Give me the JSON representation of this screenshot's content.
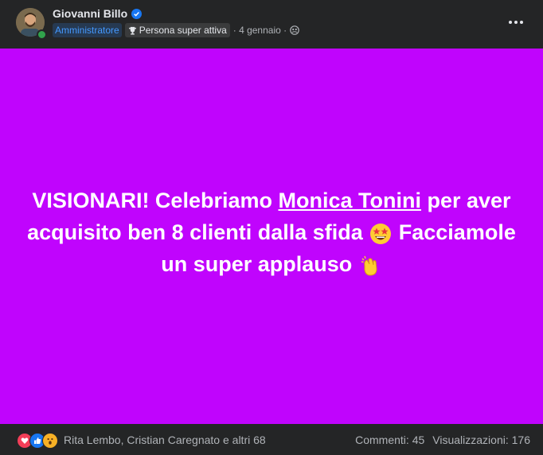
{
  "post": {
    "author": "Giovanni Billo",
    "role_badge": "Amministratore",
    "active_badge": "Persona super attiva",
    "date": "· 4 gennaio ·",
    "text_part1": "VISIONARI! Celebriamo ",
    "mention": "Monica Tonini",
    "text_part2": " per aver acquisito ben 8 clienti dalla sfida ",
    "text_part3": " Facciamole un super applauso ",
    "background_color": "#c004fd",
    "icons": [
      "verified-icon",
      "trophy-icon",
      "group-icon",
      "more-icon",
      "star-struck-emoji",
      "clapping-hands-emoji",
      "love-reaction-icon",
      "like-reaction-icon",
      "wow-reaction-icon"
    ]
  },
  "footer": {
    "reaction_names": "Rita Lembo, Cristian Caregnato e altri 68",
    "comments": "Commenti: 45",
    "views": "Visualizzazioni: 176"
  }
}
